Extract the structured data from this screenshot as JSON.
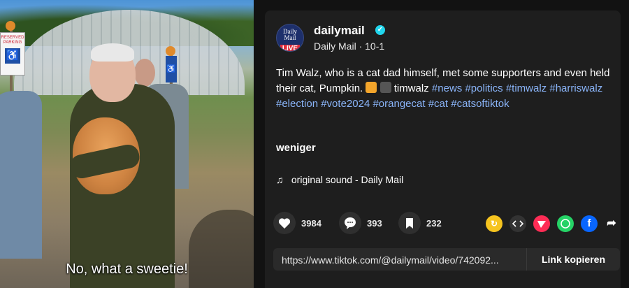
{
  "video": {
    "caption": "No, what a sweetie!"
  },
  "post": {
    "author": {
      "username": "dailymail",
      "display_name_and_date": "Daily Mail · 10-1",
      "avatar_text": "Daily Mail",
      "avatar_badge": "LIVE"
    },
    "description": {
      "text": "Tim Walz, who is a cat dad himself, met some supporters and even held their cat, Pumpkin.",
      "mention": "timwalz",
      "hashtags": [
        "#news",
        "#politics",
        "#timwalz",
        "#harriswalz",
        "#election",
        "#vote2024",
        "#orangecat",
        "#cat",
        "#catsoftiktok"
      ]
    },
    "less_label": "weniger",
    "sound": "original sound - Daily Mail"
  },
  "stats": {
    "likes": "3984",
    "comments": "393",
    "saves": "232"
  },
  "share": {
    "icons": [
      "repost-icon",
      "embed-icon",
      "send-icon",
      "whatsapp-icon",
      "facebook-icon",
      "share-arrow-icon"
    ],
    "colors": {
      "repost": "#f6c41f",
      "embed": "#333333",
      "send": "#fe2c55",
      "whatsapp": "#25d366",
      "facebook": "#0866ff"
    }
  },
  "link": {
    "url": "https://www.tiktok.com/@dailymail/video/742092...",
    "copy_label": "Link kopieren"
  },
  "colors": {
    "hashtag": "#8ab4f8",
    "verified": "#20d5ec"
  }
}
